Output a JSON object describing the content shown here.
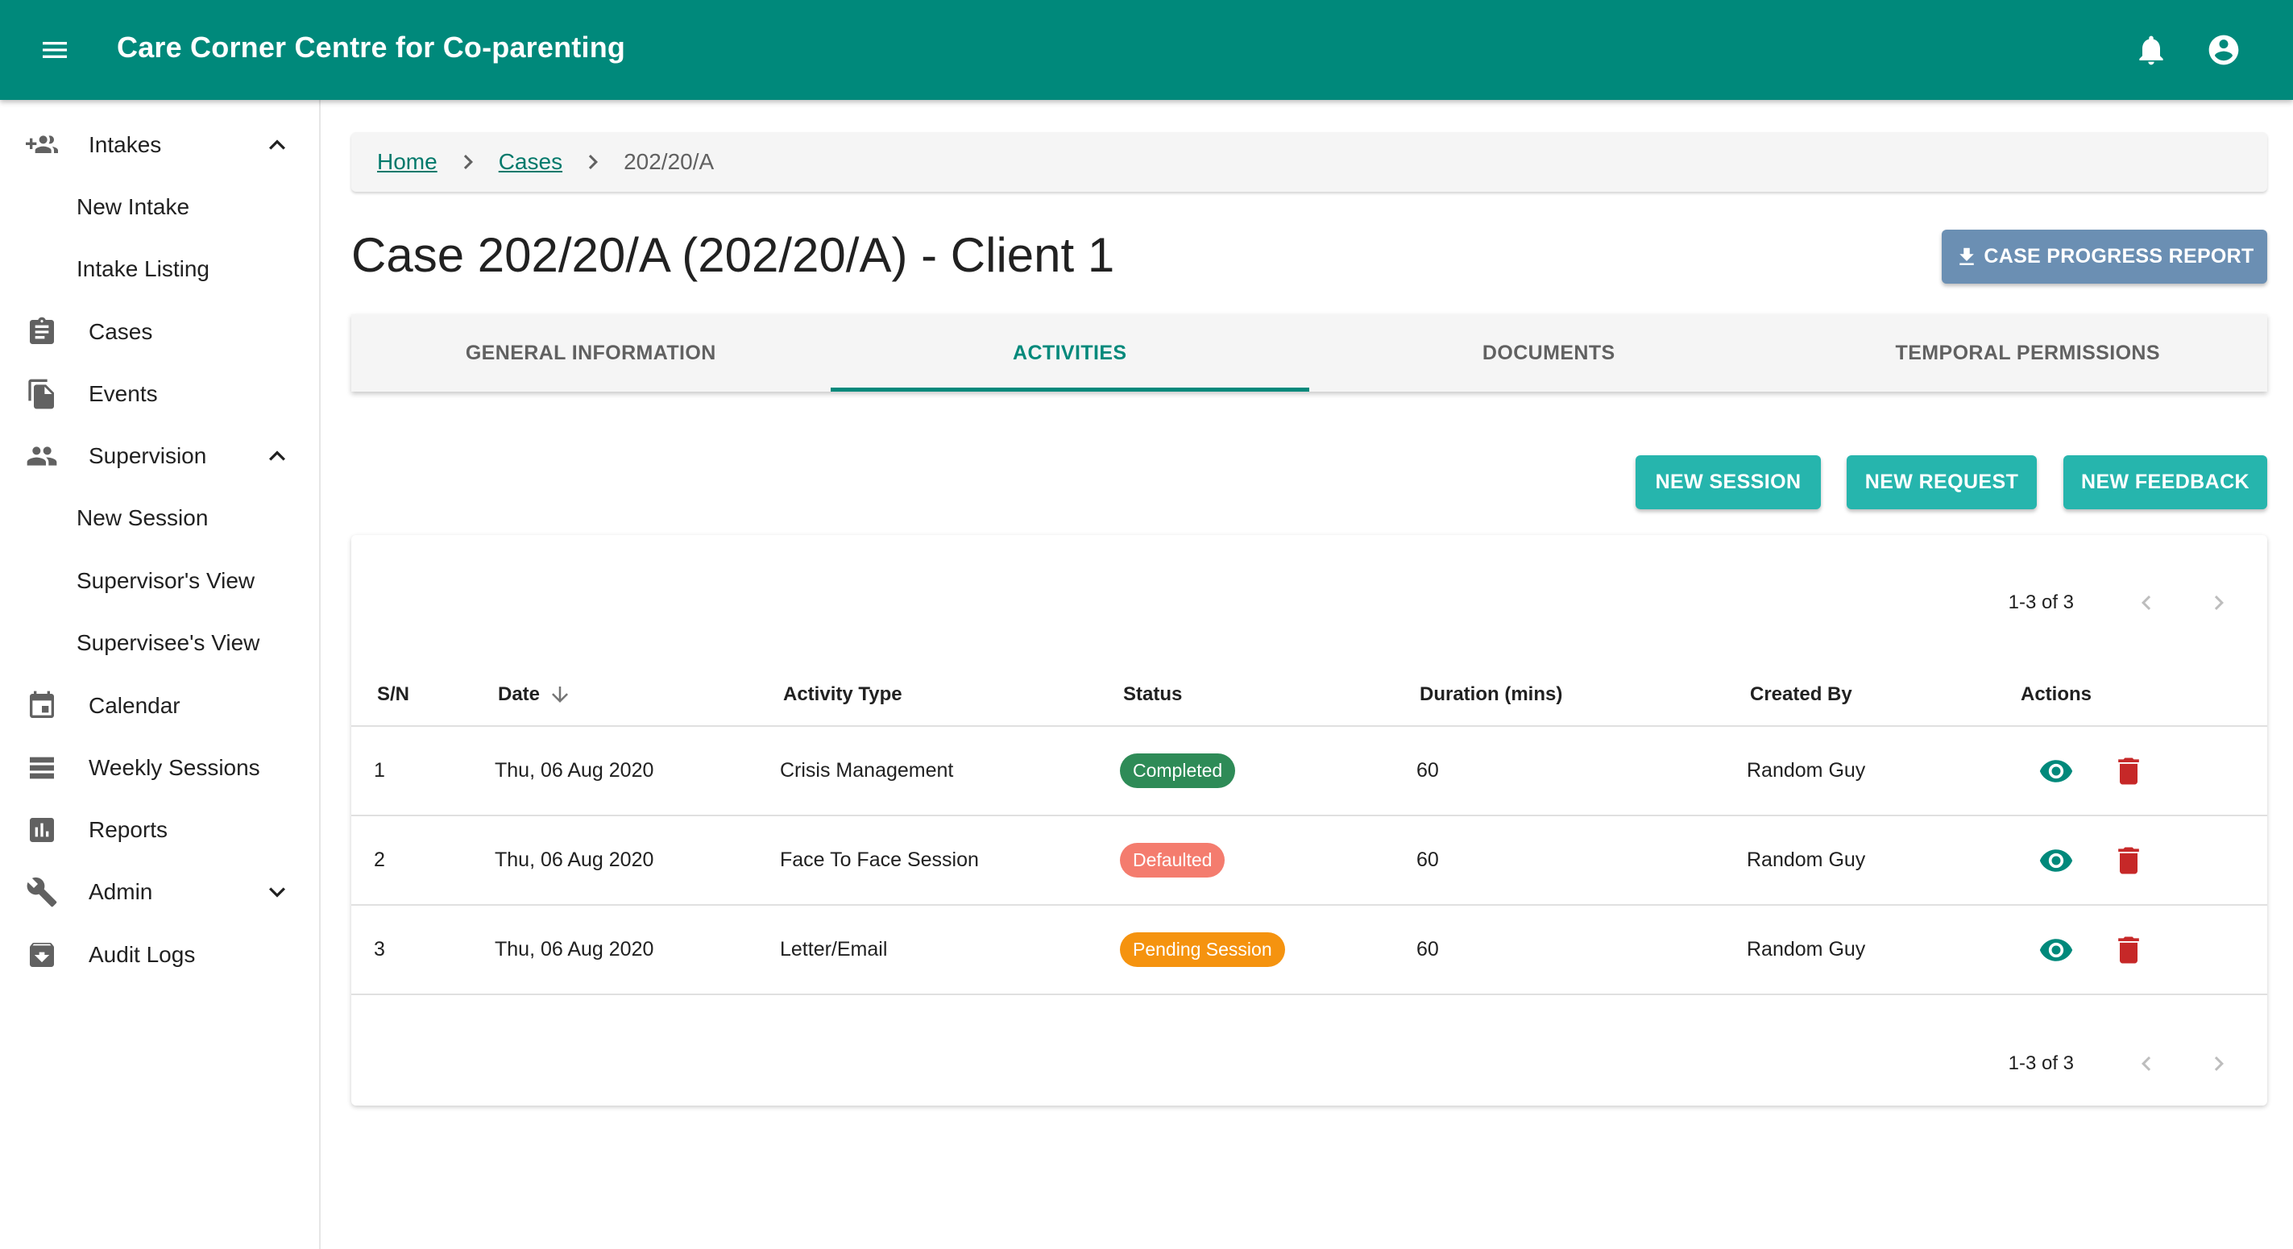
{
  "app": {
    "title": "Care Corner Centre for Co-parenting",
    "menu_icon": "menu-icon",
    "notifications_icon": "bell-icon",
    "account_icon": "account-circle-icon",
    "brand_color": "#00897b"
  },
  "sidebar": {
    "items": [
      {
        "label": "Intakes",
        "icon": "group-add-icon",
        "expanded": true
      },
      {
        "label": "New Intake"
      },
      {
        "label": "Intake Listing"
      },
      {
        "label": "Cases",
        "icon": "clipboard-icon"
      },
      {
        "label": "Events",
        "icon": "file-copy-icon"
      },
      {
        "label": "Supervision",
        "icon": "people-icon",
        "expanded": true
      },
      {
        "label": "New Session"
      },
      {
        "label": "Supervisor's View"
      },
      {
        "label": "Supervisee's View"
      },
      {
        "label": "Calendar",
        "icon": "calendar-icon"
      },
      {
        "label": "Weekly Sessions",
        "icon": "view-list-icon"
      },
      {
        "label": "Reports",
        "icon": "bar-chart-icon"
      },
      {
        "label": "Admin",
        "icon": "wrench-icon",
        "expanded": false
      },
      {
        "label": "Audit Logs",
        "icon": "archive-icon"
      }
    ]
  },
  "breadcrumb": {
    "home": "Home",
    "cases": "Cases",
    "current": "202/20/A"
  },
  "page": {
    "title": "Case 202/20/A (202/20/A) - Client 1",
    "report_button": "CASE PROGRESS REPORT"
  },
  "tabs": [
    {
      "label": "GENERAL INFORMATION",
      "active": false
    },
    {
      "label": "ACTIVITIES",
      "active": true
    },
    {
      "label": "DOCUMENTS",
      "active": false
    },
    {
      "label": "TEMPORAL PERMISSIONS",
      "active": false
    }
  ],
  "actions": {
    "new_session": "NEW SESSION",
    "new_request": "NEW REQUEST",
    "new_feedback": "NEW FEEDBACK"
  },
  "table": {
    "pagination": "1-3 of 3",
    "columns": {
      "sn": "S/N",
      "date": "Date",
      "activity_type": "Activity Type",
      "status": "Status",
      "duration": "Duration (mins)",
      "created_by": "Created By",
      "actions": "Actions"
    },
    "rows": [
      {
        "sn": "1",
        "date": "Thu, 06 Aug 2020",
        "activity_type": "Crisis Management",
        "status": "Completed",
        "status_color": "#2e8b57",
        "duration": "60",
        "created_by": "Random Guy"
      },
      {
        "sn": "2",
        "date": "Thu, 06 Aug 2020",
        "activity_type": "Face To Face Session",
        "status": "Defaulted",
        "status_color": "#f47c6e",
        "duration": "60",
        "created_by": "Random Guy"
      },
      {
        "sn": "3",
        "date": "Thu, 06 Aug 2020",
        "activity_type": "Letter/Email",
        "status": "Pending Session",
        "status_color": "#f5930f",
        "duration": "60",
        "created_by": "Random Guy"
      }
    ]
  }
}
